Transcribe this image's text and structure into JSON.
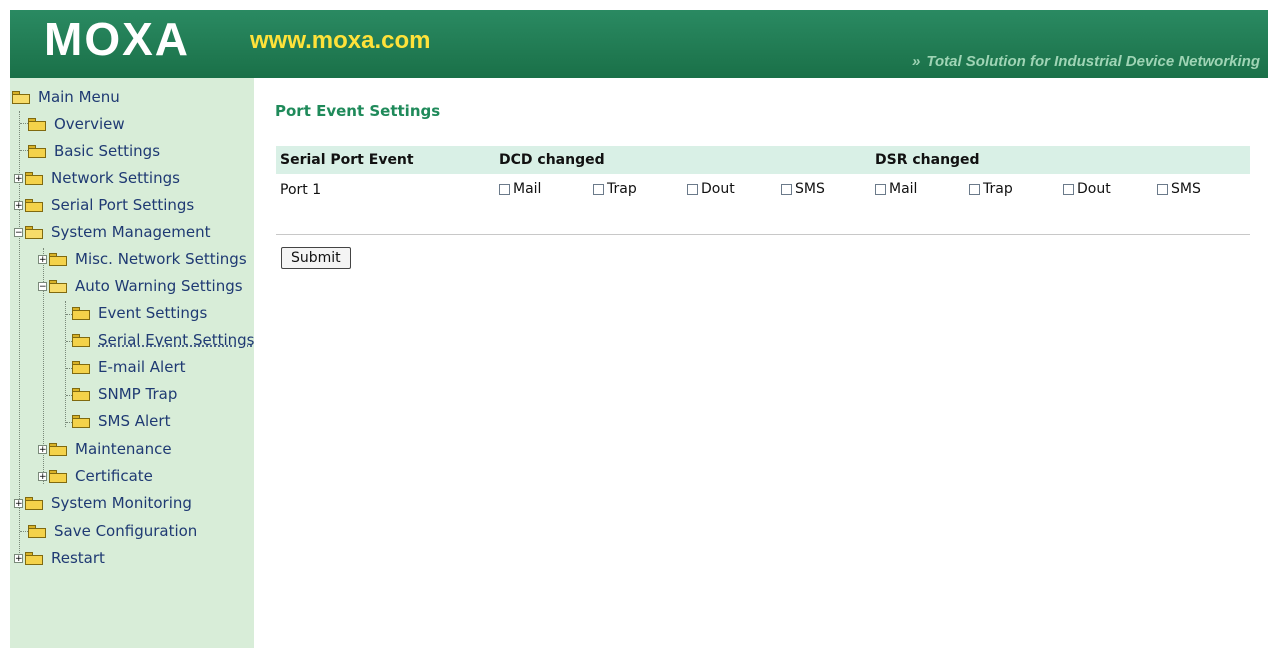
{
  "header": {
    "logo": "MOXA",
    "url": "www.moxa.com",
    "slogan_arrows": "»",
    "slogan": "Total Solution for Industrial Device Networking",
    "colors": {
      "banner": "#1a7048",
      "url": "#ffe23a",
      "slogan": "#9fd4b5"
    }
  },
  "sidebar": {
    "items": [
      {
        "label": "Main Menu",
        "icon": "folder-open-icon"
      },
      {
        "label": "Overview",
        "icon": "folder-icon"
      },
      {
        "label": "Basic Settings",
        "icon": "folder-icon"
      },
      {
        "label": "Network Settings",
        "icon": "folder-icon",
        "expander": "+"
      },
      {
        "label": "Serial Port Settings",
        "icon": "folder-icon",
        "expander": "+"
      },
      {
        "label": "System Management",
        "icon": "folder-open-icon",
        "expander": "−"
      },
      {
        "label": "Misc. Network Settings",
        "icon": "folder-icon",
        "expander": "+"
      },
      {
        "label": "Auto Warning Settings",
        "icon": "folder-open-icon",
        "expander": "−"
      },
      {
        "label": "Event Settings",
        "icon": "folder-icon"
      },
      {
        "label": "Serial Event Settings",
        "icon": "folder-icon",
        "selected": true
      },
      {
        "label": "E-mail Alert",
        "icon": "folder-icon"
      },
      {
        "label": "SNMP Trap",
        "icon": "folder-icon"
      },
      {
        "label": "SMS Alert",
        "icon": "folder-icon"
      },
      {
        "label": "Maintenance",
        "icon": "folder-icon",
        "expander": "+"
      },
      {
        "label": "Certificate",
        "icon": "folder-icon",
        "expander": "+"
      },
      {
        "label": "System Monitoring",
        "icon": "folder-icon",
        "expander": "+"
      },
      {
        "label": "Save Configuration",
        "icon": "folder-icon"
      },
      {
        "label": "Restart",
        "icon": "folder-icon",
        "expander": "+"
      }
    ]
  },
  "main": {
    "title": "Port Event Settings",
    "table": {
      "headers": [
        "Serial Port Event",
        "DCD changed",
        "DSR changed"
      ],
      "row": {
        "port": "Port 1",
        "dcd": [
          "Mail",
          "Trap",
          "Dout",
          "SMS"
        ],
        "dsr": [
          "Mail",
          "Trap",
          "Dout",
          "SMS"
        ]
      }
    },
    "submit_label": "Submit"
  }
}
